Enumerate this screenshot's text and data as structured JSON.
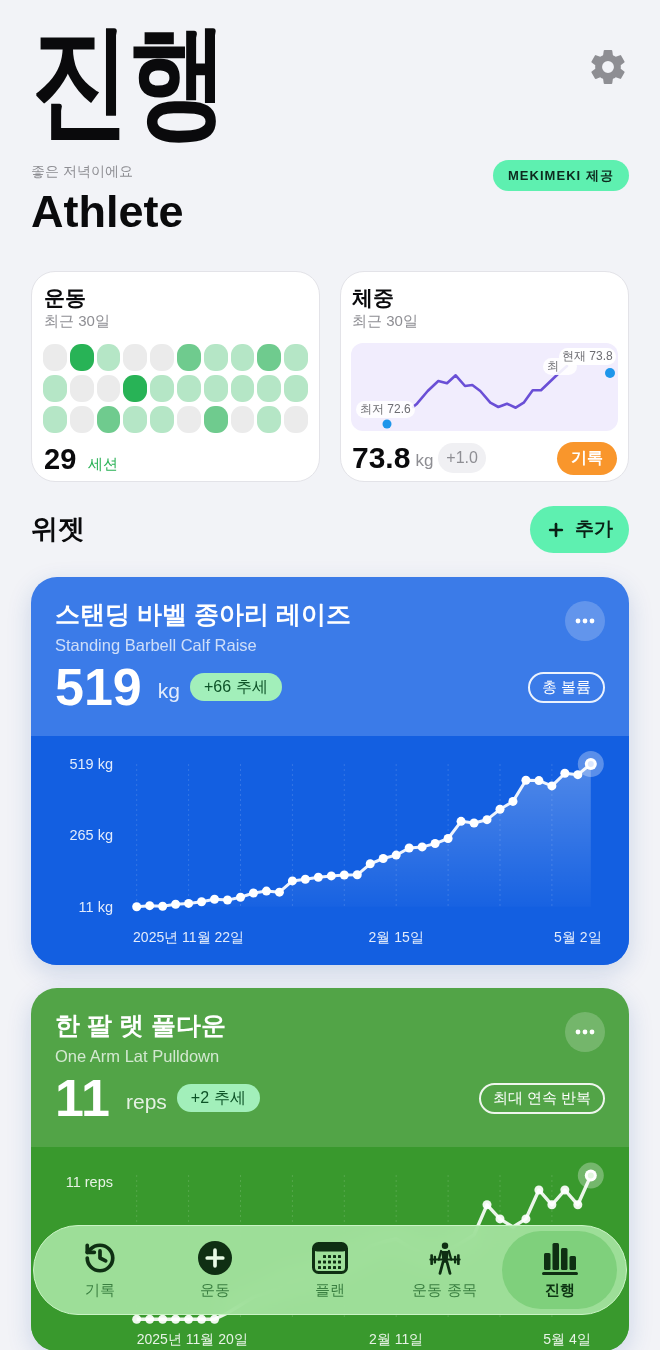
{
  "header": {
    "title": "진행",
    "greeting": "좋은 저녁이에요",
    "badge": "MEKIMEKI 제공",
    "name": "Athlete"
  },
  "workouts_card": {
    "title": "운동",
    "subtitle": "최근 30일",
    "cells": [
      {
        "color": "#ebebeb"
      },
      {
        "color": "#28b356"
      },
      {
        "color": "#b5e6c6"
      },
      {
        "color": "#ebebeb"
      },
      {
        "color": "#ebebeb"
      },
      {
        "color": "#6fcb8e"
      },
      {
        "color": "#b5e6c6"
      },
      {
        "color": "#b5e6c6"
      },
      {
        "color": "#6fcb8e"
      },
      {
        "color": "#b5e6c6"
      },
      {
        "color": "#b5e6c6"
      },
      {
        "color": "#ebebeb"
      },
      {
        "color": "#ebebeb"
      },
      {
        "color": "#28b356"
      },
      {
        "color": "#b5e6c6"
      },
      {
        "color": "#b5e6c6"
      },
      {
        "color": "#b5e6c6"
      },
      {
        "color": "#b5e6c6"
      },
      {
        "color": "#b5e6c6"
      },
      {
        "color": "#b5e6c6"
      },
      {
        "color": "#b5e6c6"
      },
      {
        "color": "#ebebeb"
      },
      {
        "color": "#6fcb8e"
      },
      {
        "color": "#b5e6c6"
      },
      {
        "color": "#b5e6c6"
      },
      {
        "color": "#ebebeb"
      },
      {
        "color": "#6fcb8e"
      },
      {
        "color": "#ebebeb"
      },
      {
        "color": "#b5e6c6"
      },
      {
        "color": "#ebebeb"
      }
    ],
    "count": "29",
    "unit": "세션"
  },
  "weight_card": {
    "title": "체중",
    "subtitle": "최근 30일",
    "chart": {
      "min_label": "최저 72.6",
      "max_label": "최",
      "current_label": "현재 73.8"
    },
    "value": "73.8",
    "unit": "kg",
    "change": "+1.0",
    "button": "기록"
  },
  "widgets_header": {
    "title": "위젯",
    "add_button": "추가"
  },
  "widgets": [
    {
      "color": "#3b7be8",
      "title": "스탠딩 바벨 종아리 레이즈",
      "subtitle": "Standing Barbell Calf Raise",
      "value": "519",
      "unit": "kg",
      "trend": "+66 추세",
      "metric": "총 볼륨",
      "chart_data": {
        "type": "area",
        "grid": true,
        "categories": [
          null,
          null,
          null,
          null,
          "2025년 11월 22일",
          null,
          null,
          null,
          null,
          null,
          null,
          null,
          null,
          null,
          null,
          null,
          null,
          null,
          null,
          null,
          "2월 15일",
          null,
          null,
          null,
          null,
          null,
          null,
          null,
          null,
          null,
          null,
          null,
          null,
          null,
          "5월 2일",
          null
        ],
        "values": [
          11,
          15,
          13,
          20,
          23,
          29,
          38,
          35,
          45,
          60,
          67,
          63,
          103,
          109,
          116,
          121,
          124,
          125,
          164,
          183,
          195,
          220,
          224,
          236,
          254,
          315,
          309,
          321,
          358,
          386,
          461,
          460,
          441,
          486,
          481,
          519
        ],
        "ylim": [
          11,
          519
        ],
        "yticks": [
          {
            "value": 519,
            "label": "519 kg"
          },
          {
            "value": 265,
            "label": "265 kg"
          },
          {
            "value": 11,
            "label": "11 kg"
          }
        ]
      }
    },
    {
      "color": "#52a447",
      "title": "한 팔 랫 풀다운",
      "subtitle": "One Arm Lat Pulldown",
      "value": "11",
      "unit": "reps",
      "trend": "+2 추세",
      "metric": "최대 연속 반복",
      "chart": {
        "y_label": "11 reps",
        "x_labels": [
          "2025년 11월 20일",
          "2월 11일",
          "5월 4일"
        ]
      }
    }
  ],
  "tab_bar": [
    {
      "label": "기록",
      "selected": false
    },
    {
      "label": "운동",
      "selected": false
    },
    {
      "label": "플랜",
      "selected": false
    },
    {
      "label": "운동 종목",
      "selected": false
    },
    {
      "label": "진행",
      "selected": true
    }
  ]
}
